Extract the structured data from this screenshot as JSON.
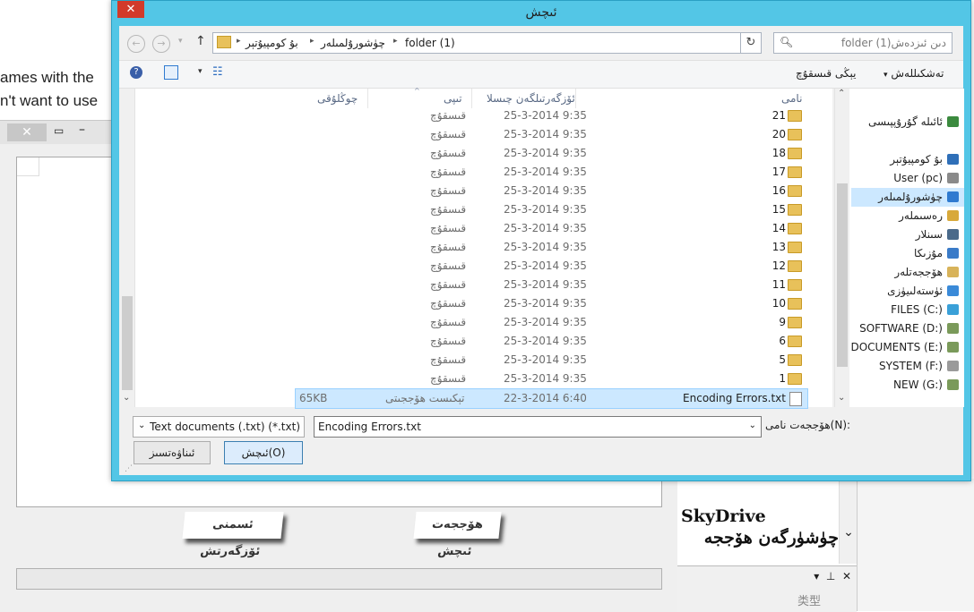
{
  "background": {
    "text_lines": [
      "ames with the",
      "n't want to use"
    ],
    "buttons": {
      "save_text": "ئسمنى ئۆزگەرتش",
      "open_file": "هۆججەت ئىچش"
    },
    "skydrive": {
      "title": "SkyDrive",
      "subtitle": "چۈشۈرگەن هۆججە"
    },
    "pane_label": "类型"
  },
  "dialog": {
    "title": "ئىچش",
    "address": {
      "crumbs": [
        "بۇ كومپيۇتېر",
        "چۈشورۇلمىلەر",
        "folder (1)"
      ]
    },
    "search_placeholder": "folder (1)دىن ئىزدەش",
    "toolbar": {
      "organize": "تەشكىللەش",
      "new_folder": "يېڭى قىسقۇچ"
    },
    "columns": {
      "name": "نامى",
      "date": "ئۆزگەرتىلگەن چىسلا",
      "type": "تىپى",
      "size": "چوڭلۇقى"
    },
    "files": [
      {
        "name": "21",
        "date": "25-3-2014 9:35",
        "type": "قىسقۇچ"
      },
      {
        "name": "20",
        "date": "25-3-2014 9:35",
        "type": "قىسقۇچ"
      },
      {
        "name": "18",
        "date": "25-3-2014 9:35",
        "type": "قىسقۇچ"
      },
      {
        "name": "17",
        "date": "25-3-2014 9:35",
        "type": "قىسقۇچ"
      },
      {
        "name": "16",
        "date": "25-3-2014 9:35",
        "type": "قىسقۇچ"
      },
      {
        "name": "15",
        "date": "25-3-2014 9:35",
        "type": "قىسقۇچ"
      },
      {
        "name": "14",
        "date": "25-3-2014 9:35",
        "type": "قىسقۇچ"
      },
      {
        "name": "13",
        "date": "25-3-2014 9:35",
        "type": "قىسقۇچ"
      },
      {
        "name": "12",
        "date": "25-3-2014 9:35",
        "type": "قىسقۇچ"
      },
      {
        "name": "11",
        "date": "25-3-2014 9:35",
        "type": "قىسقۇچ"
      },
      {
        "name": "10",
        "date": "25-3-2014 9:35",
        "type": "قىسقۇچ"
      },
      {
        "name": "9",
        "date": "25-3-2014 9:35",
        "type": "قىسقۇچ"
      },
      {
        "name": "6",
        "date": "25-3-2014 9:35",
        "type": "قىسقۇچ"
      },
      {
        "name": "5",
        "date": "25-3-2014 9:35",
        "type": "قىسقۇچ"
      },
      {
        "name": "1",
        "date": "25-3-2014 9:35",
        "type": "قىسقۇچ"
      }
    ],
    "selected_file": {
      "name": "Encoding Errors.txt",
      "date": "22-3-2014 6:40",
      "type": "تېكىست هۆججىتى",
      "size": "65KB"
    },
    "nav": [
      {
        "label": "ئائىلە گۇرۇپپىسى",
        "icon": "homegroup-icon",
        "color": "#3b8a3e"
      },
      {
        "label": "بۇ كومپيۇتېر",
        "icon": "computer-icon",
        "color": "#2f6fb8"
      },
      {
        "label": "User (pc)",
        "icon": "user-pc-icon",
        "color": "#8a8a8a"
      },
      {
        "label": "چۈشورۇلمىلەر",
        "icon": "downloads-icon",
        "color": "#2f7ad0"
      },
      {
        "label": "رەسىملەر",
        "icon": "pictures-icon",
        "color": "#d8a93a"
      },
      {
        "label": "سىنلار",
        "icon": "videos-icon",
        "color": "#4a6a8a"
      },
      {
        "label": "مۇزىكا",
        "icon": "music-icon",
        "color": "#3a7bc8"
      },
      {
        "label": "هۆججەتلەر",
        "icon": "documents-icon",
        "color": "#d8b35a"
      },
      {
        "label": "ئۈستەلىيۈزى",
        "icon": "desktop-icon",
        "color": "#3a8ad8"
      },
      {
        "label": "FILES (C:)",
        "icon": "windows-drive-icon",
        "color": "#3aa0d8"
      },
      {
        "label": "SOFTWARE (D:)",
        "icon": "drive-icon",
        "color": "#7a9a5a"
      },
      {
        "label": "DOCUMENTS (E:)",
        "icon": "drive-icon",
        "color": "#7a9a5a"
      },
      {
        "label": "SYSTEM (F:)",
        "icon": "removable-drive-icon",
        "color": "#9a9a9a"
      },
      {
        "label": "NEW (G:)",
        "icon": "drive-icon",
        "color": "#7a9a5a"
      }
    ],
    "filename_label": "هۆججەت نامى(N):",
    "filename_value": "Encoding Errors.txt",
    "filetype_value": "Text documents (.txt) (*.txt)",
    "open_button": "ئىچش(O)",
    "cancel_button": "ئىناۋەتسىز"
  }
}
